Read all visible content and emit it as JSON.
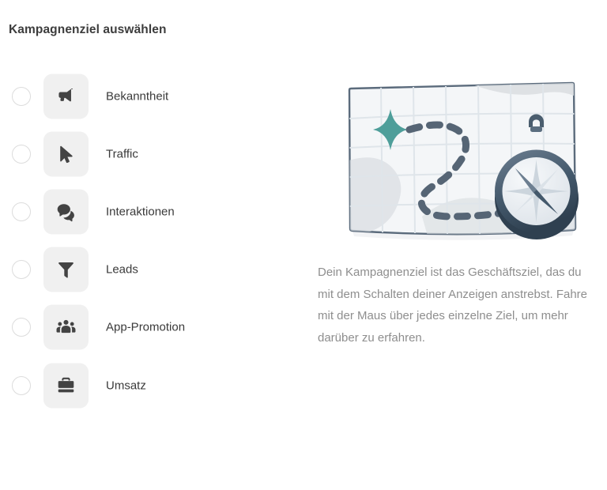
{
  "page": {
    "title": "Kampagnenziel auswählen",
    "background": "#ffffff"
  },
  "goals": {
    "selected": null,
    "items": [
      {
        "id": "awareness",
        "label": "Bekanntheit",
        "icon": "megaphone-icon"
      },
      {
        "id": "traffic",
        "label": "Traffic",
        "icon": "cursor-arrow-icon"
      },
      {
        "id": "engagement",
        "label": "Interaktionen",
        "icon": "speech-bubbles-icon"
      },
      {
        "id": "leads",
        "label": "Leads",
        "icon": "funnel-icon"
      },
      {
        "id": "app-promotion",
        "label": "App-Promotion",
        "icon": "people-group-icon"
      },
      {
        "id": "sales",
        "label": "Umsatz",
        "icon": "briefcase-icon"
      }
    ]
  },
  "info": {
    "illustration": "map-with-compass-illustration",
    "description": "Dein Kampagnenziel ist das Geschäftsziel, das du mit dem Schalten deiner Anzeigen anstrebst. Fahre mit der Maus über jedes einzelne Ziel, um mehr darüber zu erfahren."
  },
  "colors": {
    "heading": "#3d3d3d",
    "label": "#3a3a3a",
    "description": "#8e8e8e",
    "icon_tile_bg": "#f0f0f0",
    "icon_glyph": "#434343",
    "radio_border": "#dcdcdc",
    "map_paper": "#f4f6f8",
    "map_border": "#5b6b7c",
    "map_grid": "#dfe5ea",
    "route_dash": "#566575",
    "star_marker": "#4e9e9a",
    "compass_ring": "#36485a",
    "compass_face": "#eef1f4"
  }
}
